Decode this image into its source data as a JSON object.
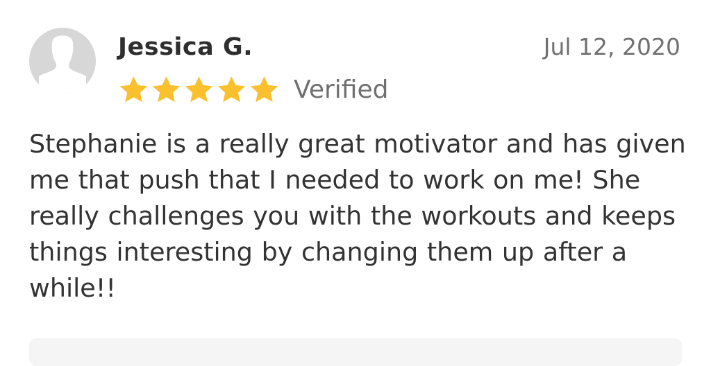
{
  "review": {
    "reviewer_name": "Jessica G.",
    "date": "Jul 12, 2020",
    "rating": 5,
    "rating_max": 5,
    "verified_label": "Verified",
    "text": "Stephanie is a really great motivator and has given me that push that I needed to work on me! She really challenges you with the workouts and keeps things interesting by changing them up after a while!!",
    "avatar_icon": "user-silhouette-icon",
    "star_icon": "star-icon"
  },
  "colors": {
    "star": "#FBC02D",
    "avatar_bg": "#D7D7D7",
    "avatar_silhouette": "#FFFFFF",
    "reply_box_bg": "#F5F5F5"
  }
}
